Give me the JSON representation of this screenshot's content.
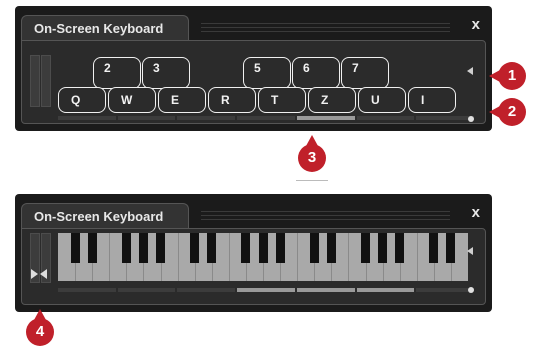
{
  "top_panel": {
    "title": "On-Screen Keyboard",
    "close_label": "x",
    "black_keys": [
      "2",
      "3",
      "5",
      "6",
      "7"
    ],
    "white_keys": [
      "Q",
      "W",
      "E",
      "R",
      "T",
      "Z",
      "U",
      "I"
    ]
  },
  "bottom_panel": {
    "title": "On-Screen Keyboard",
    "close_label": "x"
  },
  "callouts": [
    "1",
    "2",
    "3",
    "4"
  ]
}
